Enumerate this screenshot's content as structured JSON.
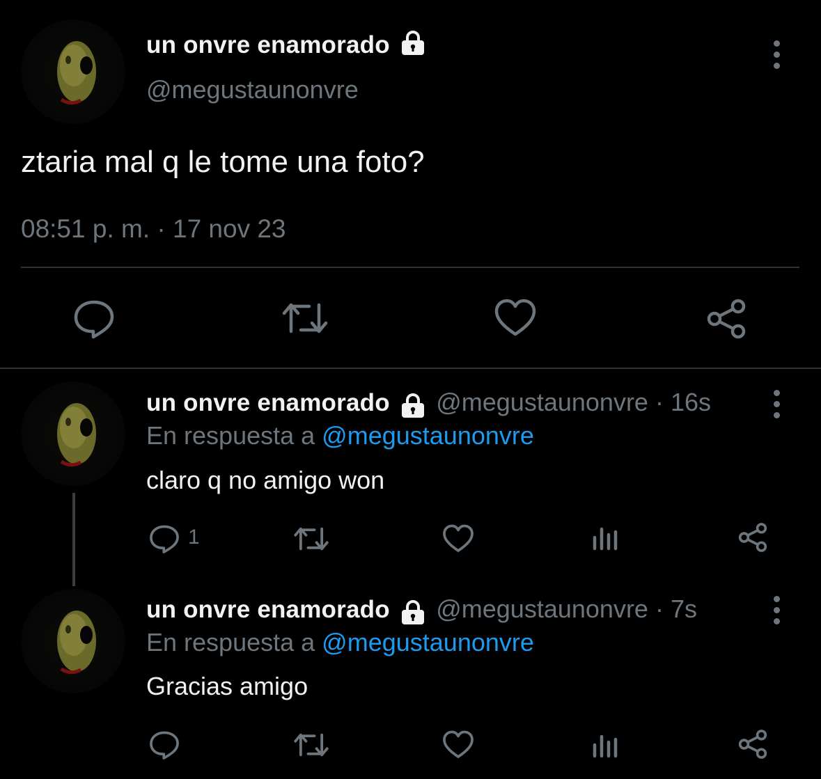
{
  "main_tweet": {
    "display_name": "un onvre enamorado",
    "handle": "@megustaunonvre",
    "text": "ztaria mal q le tome una foto?",
    "timestamp": "08:51 p. m. · 17 nov 23",
    "icons": [
      "avatar",
      "lock-icon",
      "more-icon",
      "reply-icon",
      "retweet-icon",
      "like-icon",
      "share-icon"
    ]
  },
  "replies": [
    {
      "display_name": "un onvre enamorado",
      "handle_time": "@megustaunonvre · 16s",
      "reply_to_prefix": "En respuesta a",
      "reply_to_handle": "@megustaunonvre",
      "text": "claro q no amigo won",
      "reply_count": "1"
    },
    {
      "display_name": "un onvre enamorado",
      "handle_time": "@megustaunonvre · 7s",
      "reply_to_prefix": "En respuesta a",
      "reply_to_handle": "@megustaunonvre",
      "text": "Gracias amigo",
      "reply_count": ""
    }
  ],
  "colors": {
    "background": "#000000",
    "text": "#e7e9ea",
    "muted": "#6e767d",
    "link": "#1d9bf0",
    "divider": "#2f3336"
  }
}
